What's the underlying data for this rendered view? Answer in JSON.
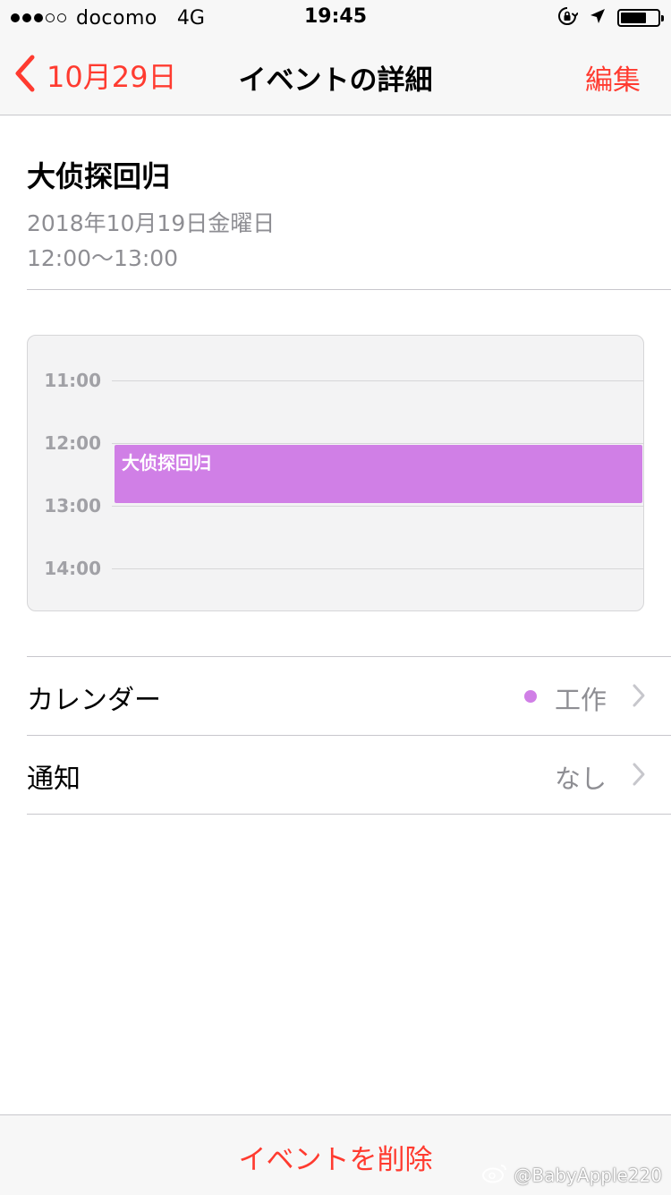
{
  "status_bar": {
    "signal_bars_filled": 3,
    "signal_bars_total": 5,
    "carrier": "docomo",
    "network": "4G",
    "time": "19:45",
    "icons": [
      "orientation-lock-icon",
      "location-arrow-icon",
      "battery-icon"
    ],
    "battery_level": 0.7
  },
  "nav": {
    "back_label": "10月29日",
    "title": "イベントの詳細",
    "edit_label": "編集"
  },
  "event": {
    "title": "大侦探回归",
    "date": "2018年10月19日金曜日",
    "time": "12:00〜13:00"
  },
  "timeline": {
    "hours": [
      "11:00",
      "12:00",
      "13:00",
      "14:00"
    ],
    "event_label": "大侦探回归",
    "event_start": "12:00",
    "event_end": "13:00",
    "event_color": "#d07fe6"
  },
  "rows": {
    "calendar": {
      "label": "カレンダー",
      "value": "工作",
      "dot_color": "#d07fe6"
    },
    "alert": {
      "label": "通知",
      "value": "なし"
    }
  },
  "bottom": {
    "delete_label": "イベントを削除"
  },
  "watermark": {
    "text": "@BabyApple220"
  },
  "colors": {
    "accent": "#ff3b30",
    "secondary_text": "#8e8e93",
    "separator": "#c8c7cc"
  }
}
